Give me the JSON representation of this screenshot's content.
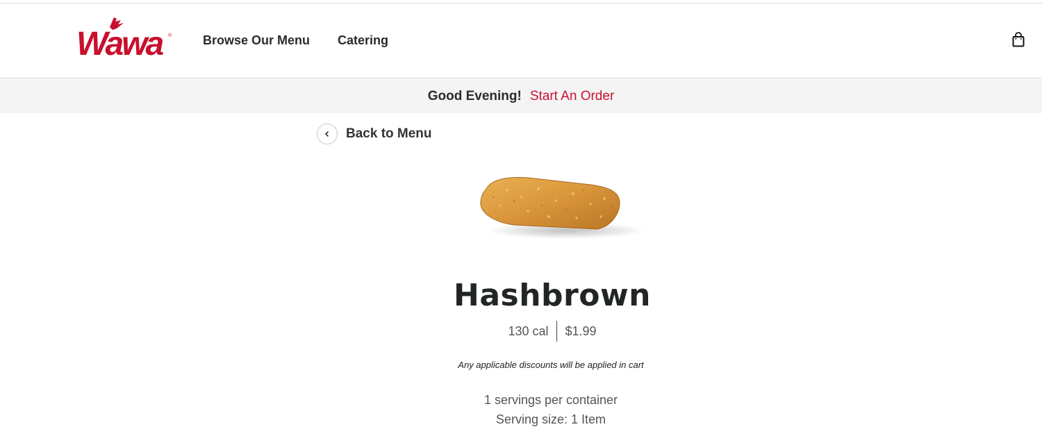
{
  "header": {
    "logo_text": "Wawa",
    "nav": {
      "browse_label": "Browse Our Menu",
      "catering_label": "Catering"
    },
    "cart_icon": "shopping-bag-icon"
  },
  "greeting_bar": {
    "greeting": "Good Evening!",
    "start_order_label": "Start An Order"
  },
  "back": {
    "label": "Back to Menu",
    "icon": "chevron-left-icon"
  },
  "product": {
    "name": "Hashbrown",
    "calories": "130 cal",
    "price": "$1.99",
    "discount_note": "Any applicable discounts will be applied in cart",
    "servings_per_container": "1 servings per container",
    "serving_size": "Serving size: 1 Item"
  },
  "colors": {
    "brand_red": "#c8102e",
    "header_bg": "#ffffff",
    "greeting_bg": "#f4f4f4",
    "text_dark": "#222222"
  }
}
